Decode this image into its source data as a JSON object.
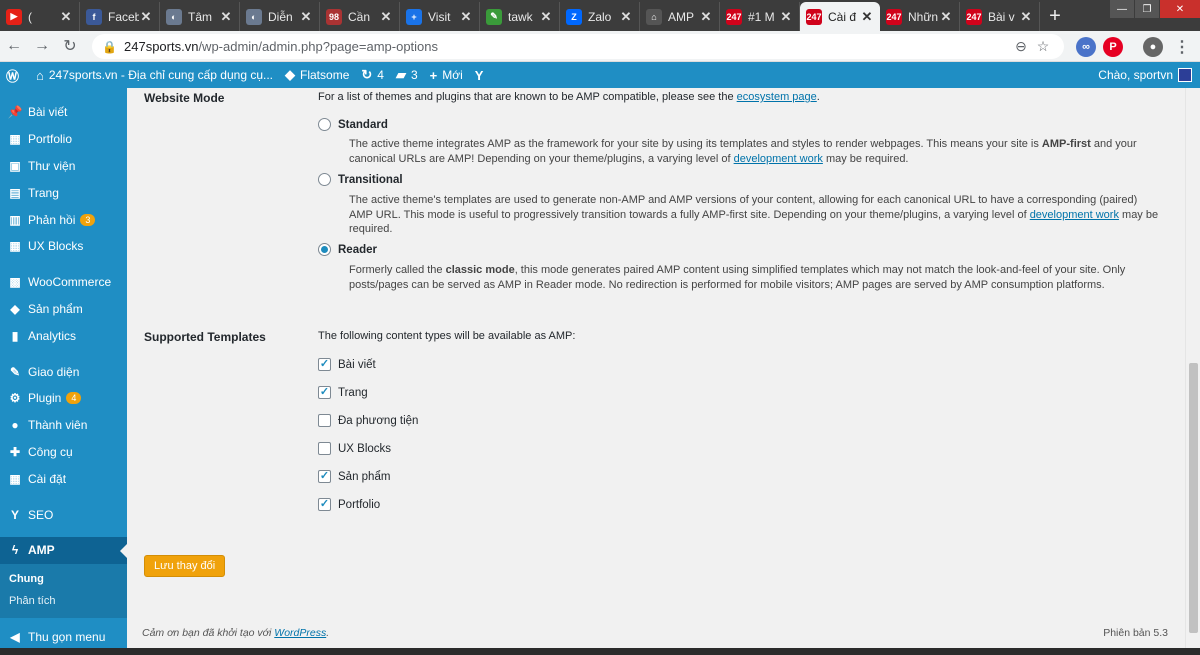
{
  "browser": {
    "tabs": [
      {
        "label": "(",
        "fav": "▶",
        "color": "#e62117"
      },
      {
        "label": "Faceb",
        "fav": "f",
        "color": "#3b5998"
      },
      {
        "label": "Tâm",
        "fav": "◐",
        "color": "#6b7a90"
      },
      {
        "label": "Diễn",
        "fav": "◐",
        "color": "#6b7a90"
      },
      {
        "label": "Cần",
        "fav": "98",
        "color": "#a33"
      },
      {
        "label": "Visit",
        "fav": "+",
        "color": "#1a73e8"
      },
      {
        "label": "tawk",
        "fav": "✎",
        "color": "#3a9b3a"
      },
      {
        "label": "Zalo",
        "fav": "Z",
        "color": "#0068ff"
      },
      {
        "label": "AMP",
        "fav": "⌂",
        "color": "#555"
      },
      {
        "label": "#1 M",
        "fav": "247",
        "color": "#d0021b"
      },
      {
        "label": "Cài đ",
        "fav": "247",
        "color": "#d0021b"
      },
      {
        "label": "Nhữn",
        "fav": "247",
        "color": "#d0021b"
      },
      {
        "label": "Bài v",
        "fav": "247",
        "color": "#d0021b"
      }
    ],
    "url_host": "247sports.vn",
    "url_path": "/wp-admin/admin.php?page=amp-options"
  },
  "adminbar": {
    "site_name": "247sports.vn - Địa chỉ cung cấp dụng cụ...",
    "theme": "Flatsome",
    "updates": "4",
    "comments": "3",
    "new_label": "Mới",
    "greeting": "Chào, sportvn"
  },
  "sidebar": {
    "items": [
      {
        "label": "Bài viết",
        "icon": "📌"
      },
      {
        "label": "Portfolio",
        "icon": "▦"
      },
      {
        "label": "Thư viện",
        "icon": "▣"
      },
      {
        "label": "Trang",
        "icon": "▤"
      },
      {
        "label": "Phản hồi",
        "icon": "▥",
        "badge": "3"
      },
      {
        "label": "UX Blocks",
        "icon": "▦"
      },
      {
        "label": "WooCommerce",
        "icon": "▩"
      },
      {
        "label": "Sản phẩm",
        "icon": "◆"
      },
      {
        "label": "Analytics",
        "icon": "▮"
      },
      {
        "label": "Giao diện",
        "icon": "✎"
      },
      {
        "label": "Plugin",
        "icon": "⚙",
        "badge": "4"
      },
      {
        "label": "Thành viên",
        "icon": "●"
      },
      {
        "label": "Công cụ",
        "icon": "✚"
      },
      {
        "label": "Cài đặt",
        "icon": "▦"
      },
      {
        "label": "SEO",
        "icon": "Y"
      },
      {
        "label": "AMP",
        "icon": "ϟ"
      }
    ],
    "submenu": [
      "Chung",
      "Phân tích"
    ],
    "collapse": "Thu gọn menu"
  },
  "content": {
    "website_mode_label": "Website Mode",
    "website_mode_intro": "For a list of themes and plugins that are known to be AMP compatible, please see the",
    "ecosystem_link": "ecosystem page",
    "modes": [
      {
        "name": "Standard",
        "selected": false,
        "desc_a": "The active theme integrates AMP as the framework for your site by using its templates and styles to render webpages. This means your site is ",
        "desc_b": "AMP-first",
        "desc_c": " and your canonical URLs are AMP! Depending on your theme/plugins, a varying level of ",
        "link": "development work",
        "desc_d": " may be required."
      },
      {
        "name": "Transitional",
        "selected": false,
        "desc_a": "The active theme's templates are used to generate non-AMP and AMP versions of your content, allowing for each canonical URL to have a corresponding (paired) AMP URL. This mode is useful to progressively transition towards a fully AMP-first site. Depending on your theme/plugins, a varying level of ",
        "link": "development work",
        "desc_d": " may be required."
      },
      {
        "name": "Reader",
        "selected": true,
        "desc_a": "Formerly called the ",
        "desc_b": "classic mode",
        "desc_c": ", this mode generates paired AMP content using simplified templates which may not match the look-and-feel of your site. Only posts/pages can be served as AMP in Reader mode. No redirection is performed for mobile visitors; AMP pages are served by AMP consumption platforms."
      }
    ],
    "templates_label": "Supported Templates",
    "templates_intro": "The following content types will be available as AMP:",
    "templates": [
      {
        "label": "Bài viết",
        "checked": true
      },
      {
        "label": "Trang",
        "checked": true
      },
      {
        "label": "Đa phương tiện",
        "checked": false
      },
      {
        "label": "UX Blocks",
        "checked": false
      },
      {
        "label": "Sản phẩm",
        "checked": true
      },
      {
        "label": "Portfolio",
        "checked": true
      }
    ],
    "save_label": "Lưu thay đổi",
    "footer_text": "Cảm ơn bạn đã khởi tạo với ",
    "footer_link": "WordPress",
    "footer_end": ".",
    "version": "Phiên bản 5.3"
  }
}
